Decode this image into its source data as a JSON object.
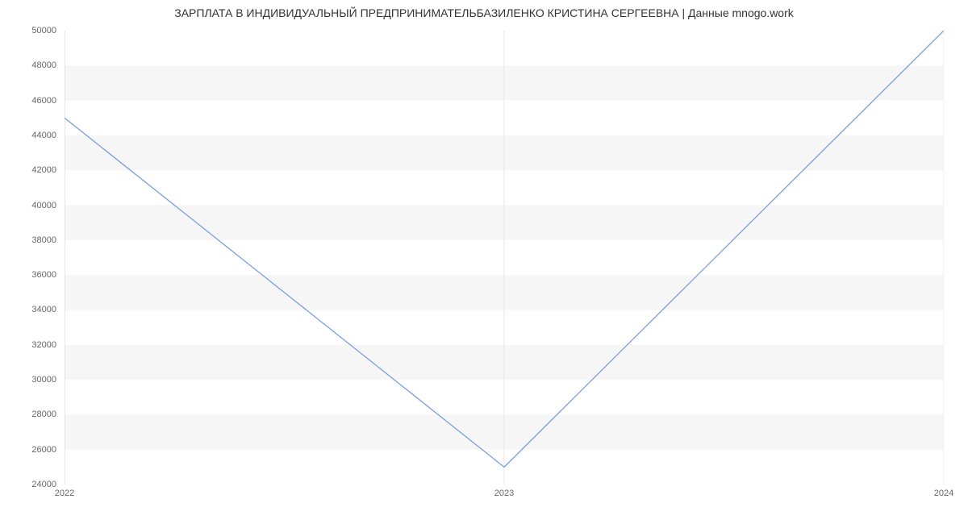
{
  "chart_data": {
    "type": "line",
    "title": "ЗАРПЛАТА В ИНДИВИДУАЛЬНЫЙ ПРЕДПРИНИМАТЕЛЬБАЗИЛЕНКО КРИСТИНА СЕРГЕЕВНА | Данные mnogo.work",
    "x": [
      "2022",
      "2023",
      "2024"
    ],
    "values": [
      45000,
      25000,
      50000
    ],
    "xlabel": "",
    "ylabel": "",
    "ylim": [
      24000,
      50000
    ],
    "y_ticks": [
      24000,
      26000,
      28000,
      30000,
      32000,
      34000,
      36000,
      38000,
      40000,
      42000,
      44000,
      46000,
      48000,
      50000
    ]
  }
}
